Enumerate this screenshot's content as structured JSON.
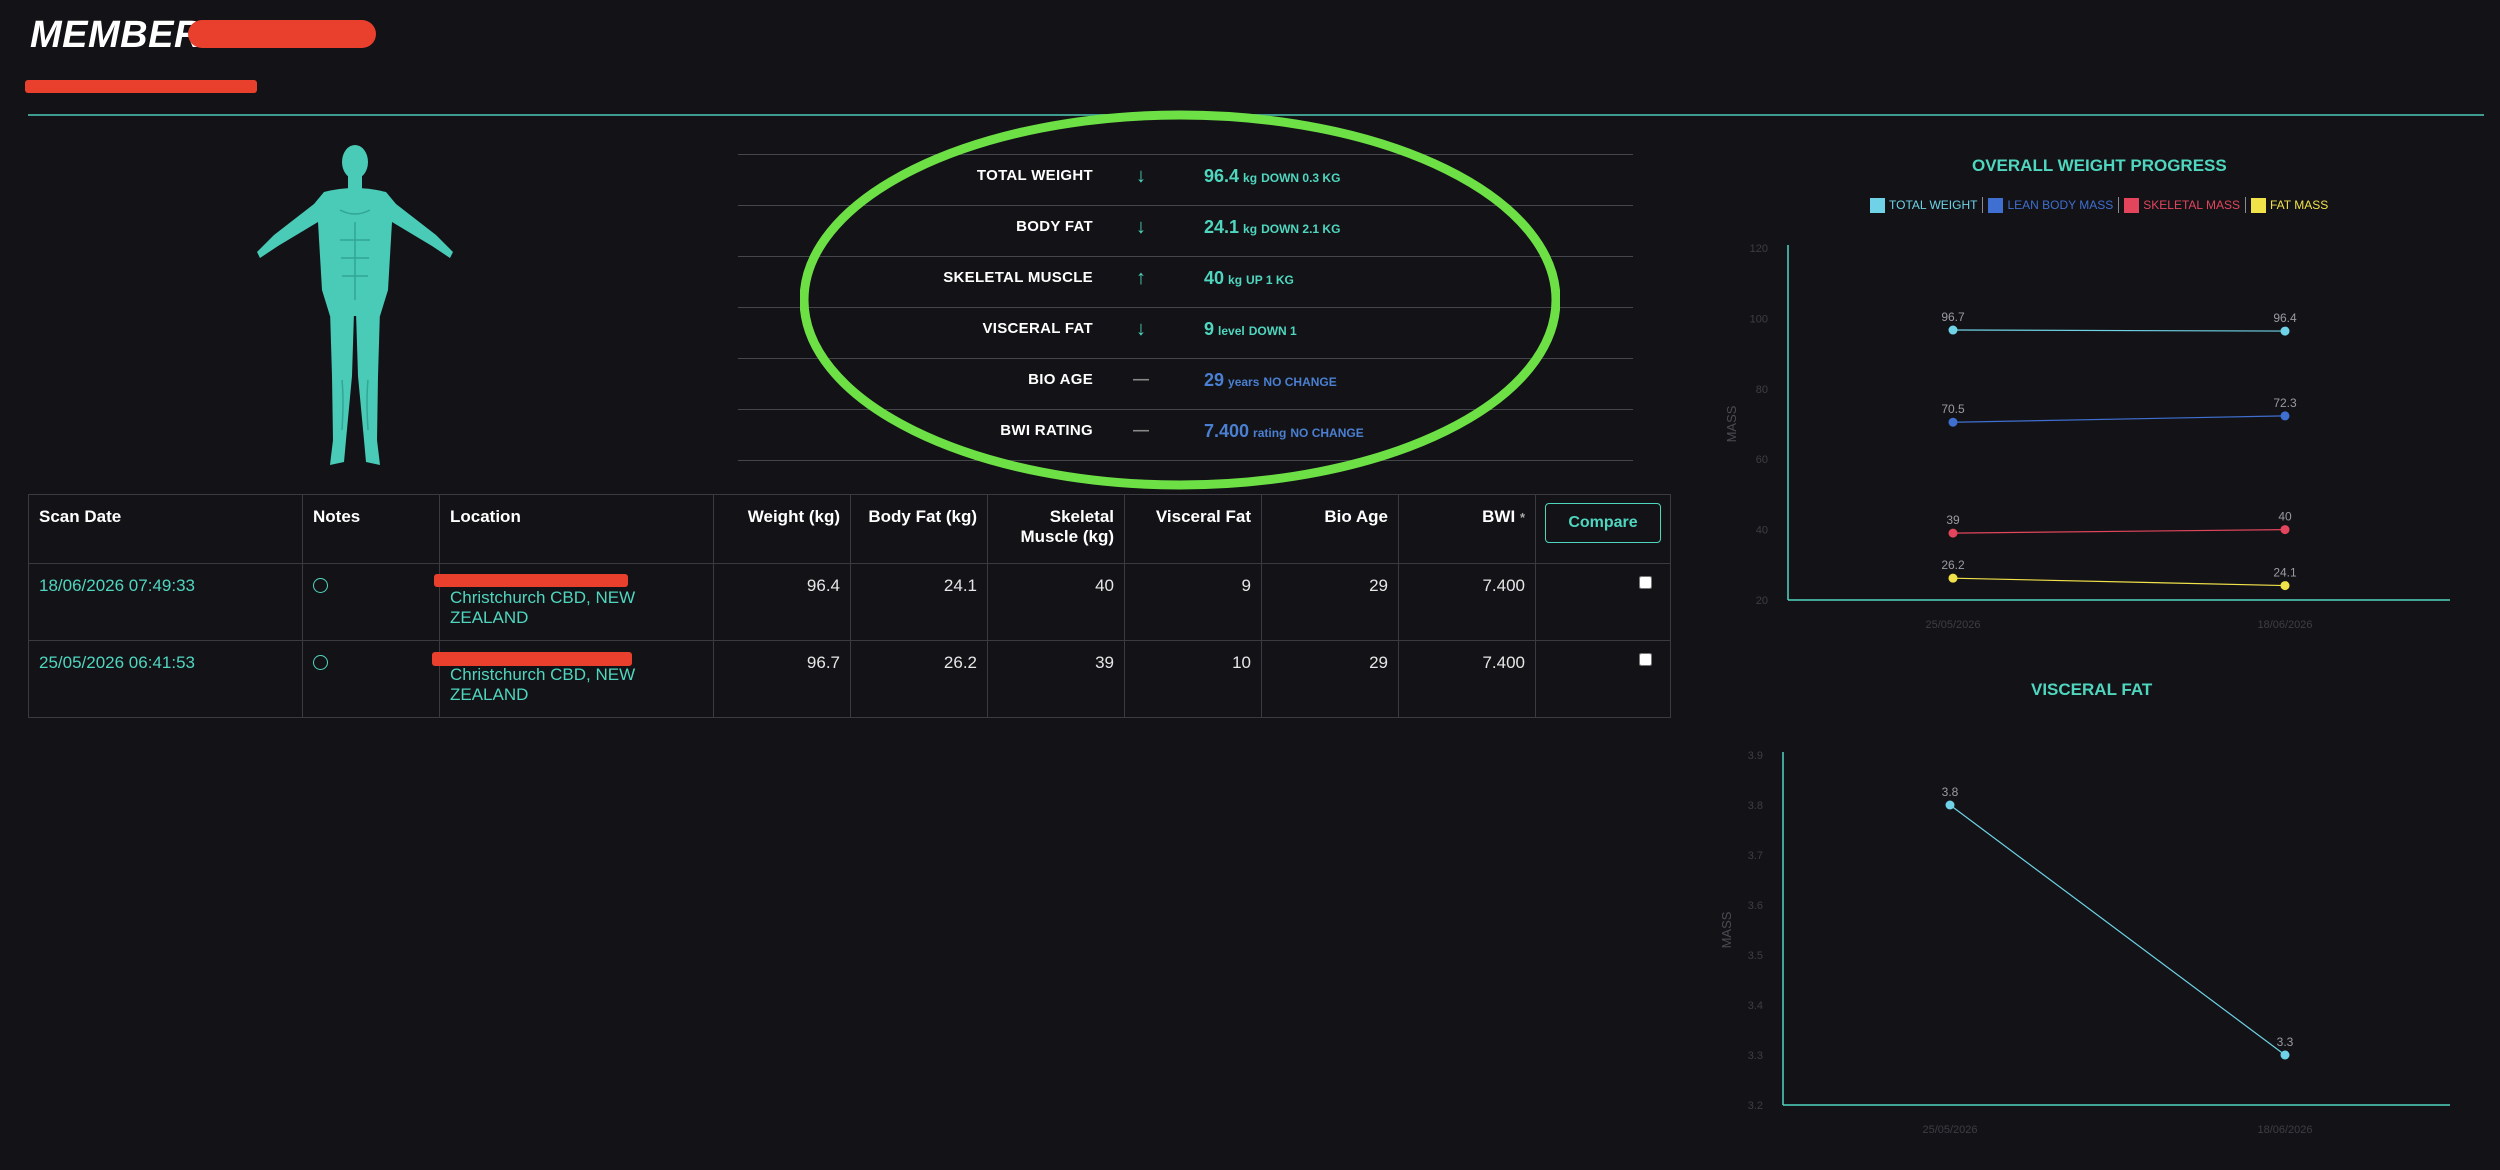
{
  "header": {
    "member_prefix": "MEMBER : "
  },
  "metrics": [
    {
      "label": "TOTAL WEIGHT",
      "icon": "arrow-down-icon",
      "icon_glyph": "↓",
      "value": "96.4",
      "unit": "kg",
      "change": "DOWN 0.3 KG"
    },
    {
      "label": "BODY FAT",
      "icon": "arrow-down-icon",
      "icon_glyph": "↓",
      "value": "24.1",
      "unit": "kg",
      "change": "DOWN 2.1 KG"
    },
    {
      "label": "SKELETAL MUSCLE",
      "icon": "arrow-up-icon",
      "icon_glyph": "↑",
      "value": "40",
      "unit": "kg",
      "change": "UP 1 KG"
    },
    {
      "label": "VISCERAL FAT",
      "icon": "arrow-down-icon",
      "icon_glyph": "↓",
      "value": "9",
      "unit": "level",
      "change": "DOWN 1"
    },
    {
      "label": "BIO AGE",
      "icon": "dash-icon",
      "icon_glyph": "—",
      "value": "29",
      "unit": "years",
      "change": "NO CHANGE"
    },
    {
      "label": "BWI RATING",
      "icon": "dash-icon",
      "icon_glyph": "—",
      "value": "7.400",
      "unit": "rating",
      "change": "NO CHANGE"
    }
  ],
  "table": {
    "headers": {
      "scan_date": "Scan Date",
      "notes": "Notes",
      "location": "Location",
      "weight": "Weight (kg)",
      "body_fat": "Body Fat (kg)",
      "skeletal_1": "Skeletal",
      "skeletal_2": "Muscle (kg)",
      "visceral": "Visceral Fat",
      "bio_age": "Bio Age",
      "bwi": "BWI",
      "bwi_mark": "*",
      "compare": "Compare"
    },
    "rows": [
      {
        "scan_date": "18/06/2026 07:49:33",
        "location": "Christchurch CBD, NEW ZEALAND",
        "weight": "96.4",
        "body_fat": "24.1",
        "skeletal": "40",
        "visceral": "9",
        "bio_age": "29",
        "bwi": "7.400"
      },
      {
        "scan_date": "25/05/2026 06:41:53",
        "location": "Christchurch CBD, NEW ZEALAND",
        "weight": "96.7",
        "body_fat": "26.2",
        "skeletal": "39",
        "visceral": "10",
        "bio_age": "29",
        "bwi": "7.400"
      }
    ]
  },
  "colors": {
    "accent": "#4fd6bf",
    "total_weight": "#6fd2e6",
    "lean_body_mass": "#3f6fd0",
    "skeletal_mass": "#e2455c",
    "fat_mass": "#f2e24a",
    "highlight": "#6de046"
  },
  "chart_data": [
    {
      "type": "line",
      "title": "OVERALL WEIGHT PROGRESS",
      "x": [
        "25/05/2026",
        "18/06/2026"
      ],
      "ylabel": "MASS",
      "ylim": [
        20,
        120
      ],
      "yticks": [
        "20",
        "40",
        "60",
        "80",
        "100",
        "120"
      ],
      "legend_position": "top",
      "series": [
        {
          "name": "TOTAL WEIGHT",
          "values": [
            96.7,
            96.4
          ],
          "labels": [
            "96.7",
            "96.4"
          ],
          "color": "#6fd2e6"
        },
        {
          "name": "LEAN BODY MASS",
          "values": [
            70.5,
            72.3
          ],
          "labels": [
            "70.5",
            "72.3"
          ],
          "color": "#3f6fd0"
        },
        {
          "name": "SKELETAL MASS",
          "values": [
            39,
            40
          ],
          "labels": [
            "39",
            "40"
          ],
          "color": "#e2455c"
        },
        {
          "name": "FAT MASS",
          "values": [
            26.2,
            24.1
          ],
          "labels": [
            "26.2",
            "24.1"
          ],
          "color": "#f2e24a"
        }
      ]
    },
    {
      "type": "line",
      "title": "VISCERAL FAT",
      "x": [
        "25/05/2026",
        "18/06/2026"
      ],
      "ylabel": "MASS",
      "ylim": [
        3.2,
        3.9
      ],
      "yticks": [
        "3.2",
        "3.3",
        "3.4",
        "3.5",
        "3.6",
        "3.7",
        "3.8",
        "3.9"
      ],
      "series": [
        {
          "values": [
            3.8,
            3.3
          ],
          "labels": [
            "3.8",
            "3.3"
          ],
          "color": "#6fd2e6"
        }
      ]
    }
  ]
}
